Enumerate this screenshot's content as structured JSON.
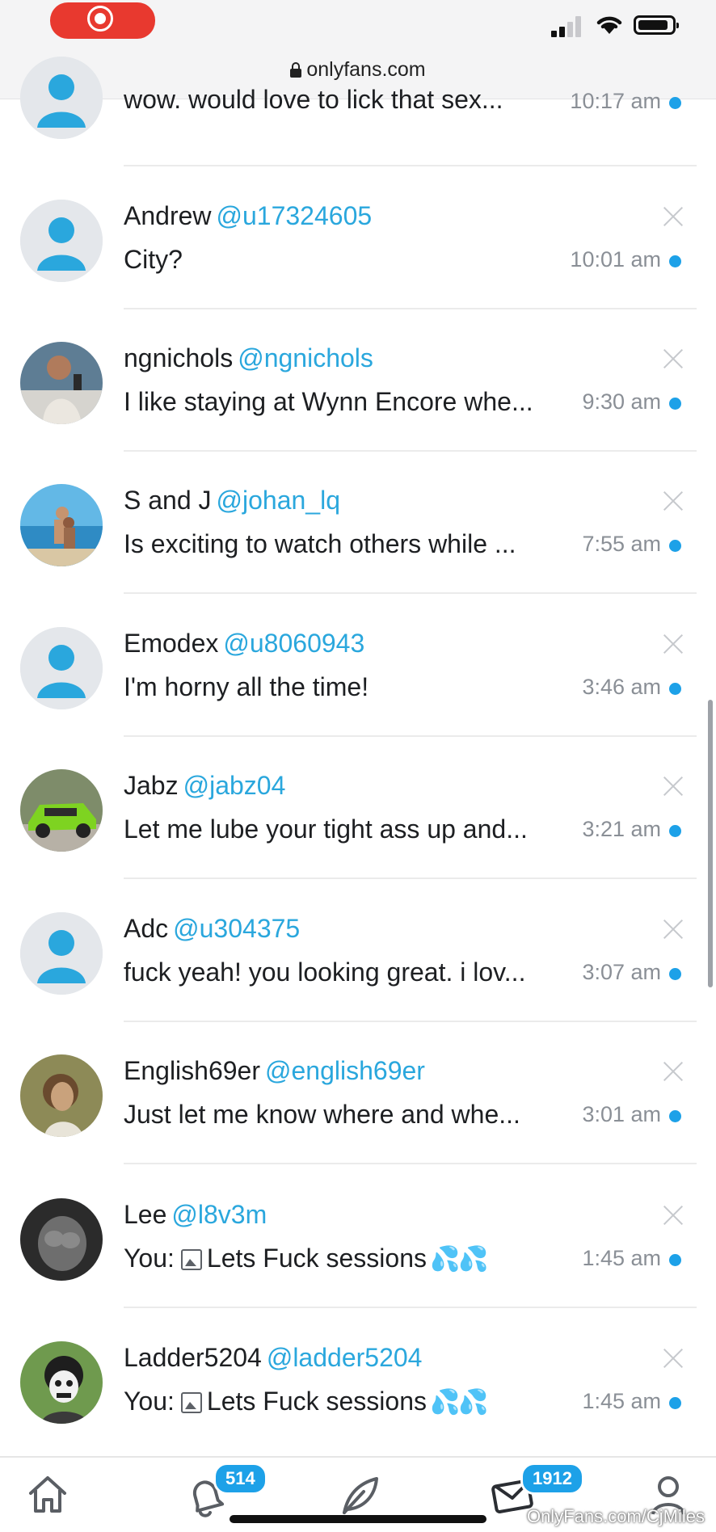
{
  "status_bar": {
    "url": "onlyfans.com"
  },
  "conversations": [
    {
      "name": "",
      "handle": "",
      "preview": "wow. would love to lick that sex...",
      "time": "10:17 am",
      "avatar": "default-user-icon"
    },
    {
      "name": "Andrew",
      "handle": "@u17324605",
      "preview": "City?",
      "time": "10:01 am",
      "avatar": "default-user-icon"
    },
    {
      "name": "ngnichols",
      "handle": "@ngnichols",
      "preview": "I like staying at Wynn Encore whe...",
      "time": "9:30 am",
      "avatar": "photo"
    },
    {
      "name": "S and J",
      "handle": "@johan_lq",
      "preview": "Is exciting to watch others while ...",
      "time": "7:55 am",
      "avatar": "photo"
    },
    {
      "name": "Emodex",
      "handle": "@u8060943",
      "preview": "I'm horny all the time!",
      "time": "3:46 am",
      "avatar": "default-user-icon"
    },
    {
      "name": "Jabz",
      "handle": "@jabz04",
      "preview": "Let me lube your tight ass up and...",
      "time": "3:21 am",
      "avatar": "photo"
    },
    {
      "name": "Adc",
      "handle": "@u304375",
      "preview": "fuck yeah! you looking great. i lov...",
      "time": "3:07 am",
      "avatar": "default-user-icon"
    },
    {
      "name": "English69er",
      "handle": "@english69er",
      "preview": "Just let me know where and whe...",
      "time": "3:01 am",
      "avatar": "photo"
    },
    {
      "name": "Lee",
      "handle": "@l8v3m",
      "preview_prefix": "You:",
      "preview": "Lets Fuck sessions",
      "preview_emoji": "💦💦",
      "time": "1:45 am",
      "avatar": "photo"
    },
    {
      "name": "Ladder5204",
      "handle": "@ladder5204",
      "preview_prefix": "You:",
      "preview": "Lets Fuck sessions",
      "preview_emoji": "💦💦",
      "time": "1:45 am",
      "avatar": "photo"
    }
  ],
  "bottom_nav": {
    "notifications_badge": "514",
    "messages_badge": "1912"
  },
  "watermark": "OnlyFans.com/CjMiles",
  "colors": {
    "accent": "#1da1e8",
    "handle": "#2aa7dd",
    "record": "#e8392f"
  }
}
